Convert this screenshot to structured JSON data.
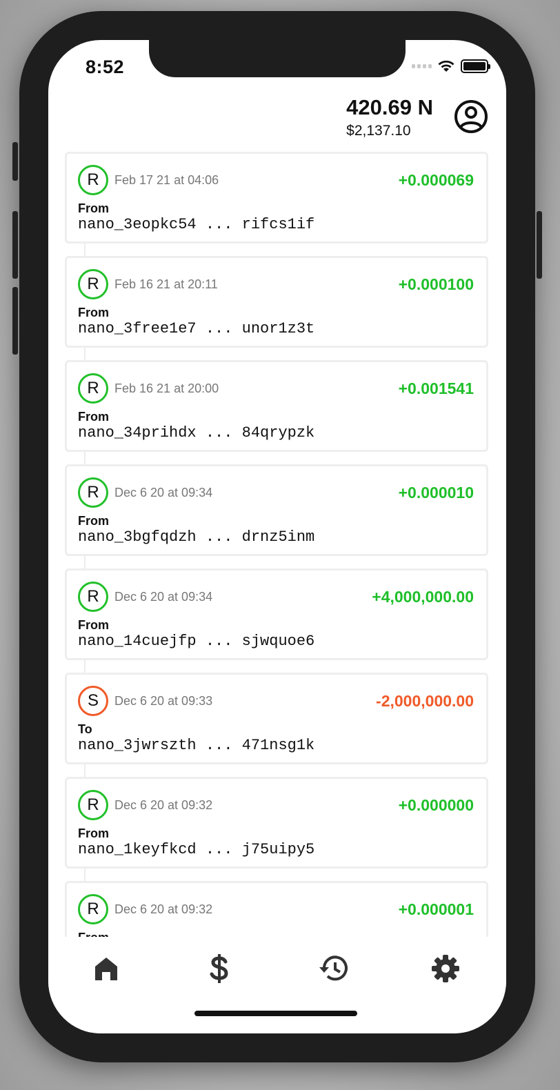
{
  "status_bar": {
    "time": "8:52"
  },
  "header": {
    "balance": "420.69 N",
    "fiat": "$2,137.10"
  },
  "transactions": [
    {
      "type": "R",
      "date": "Feb 17 21 at 04:06",
      "amount": "+0.000069",
      "direction": "From",
      "address": "nano_3eopkc54 ... rifcs1if"
    },
    {
      "type": "R",
      "date": "Feb 16 21 at 20:11",
      "amount": "+0.000100",
      "direction": "From",
      "address": "nano_3free1e7 ... unor1z3t"
    },
    {
      "type": "R",
      "date": "Feb 16 21 at 20:00",
      "amount": "+0.001541",
      "direction": "From",
      "address": "nano_34prihdx ... 84qrypzk"
    },
    {
      "type": "R",
      "date": "Dec 6 20 at 09:34",
      "amount": "+0.000010",
      "direction": "From",
      "address": "nano_3bgfqdzh ... drnz5inm"
    },
    {
      "type": "R",
      "date": "Dec 6 20 at 09:34",
      "amount": "+4,000,000.00",
      "direction": "From",
      "address": "nano_14cuejfp ... sjwquoe6"
    },
    {
      "type": "S",
      "date": "Dec 6 20 at 09:33",
      "amount": "-2,000,000.00",
      "direction": "To",
      "address": "nano_3jwrszth ... 471nsg1k"
    },
    {
      "type": "R",
      "date": "Dec 6 20 at 09:32",
      "amount": "+0.000000",
      "direction": "From",
      "address": "nano_1keyfkcd ... j75uipy5"
    },
    {
      "type": "R",
      "date": "Dec 6 20 at 09:32",
      "amount": "+0.000001",
      "direction": "From",
      "address": ""
    }
  ],
  "colors": {
    "receive": "#22c02a",
    "send": "#f05a28"
  },
  "tabs": [
    {
      "icon": "home-icon"
    },
    {
      "icon": "dollar-icon"
    },
    {
      "icon": "history-icon"
    },
    {
      "icon": "gear-icon"
    }
  ]
}
